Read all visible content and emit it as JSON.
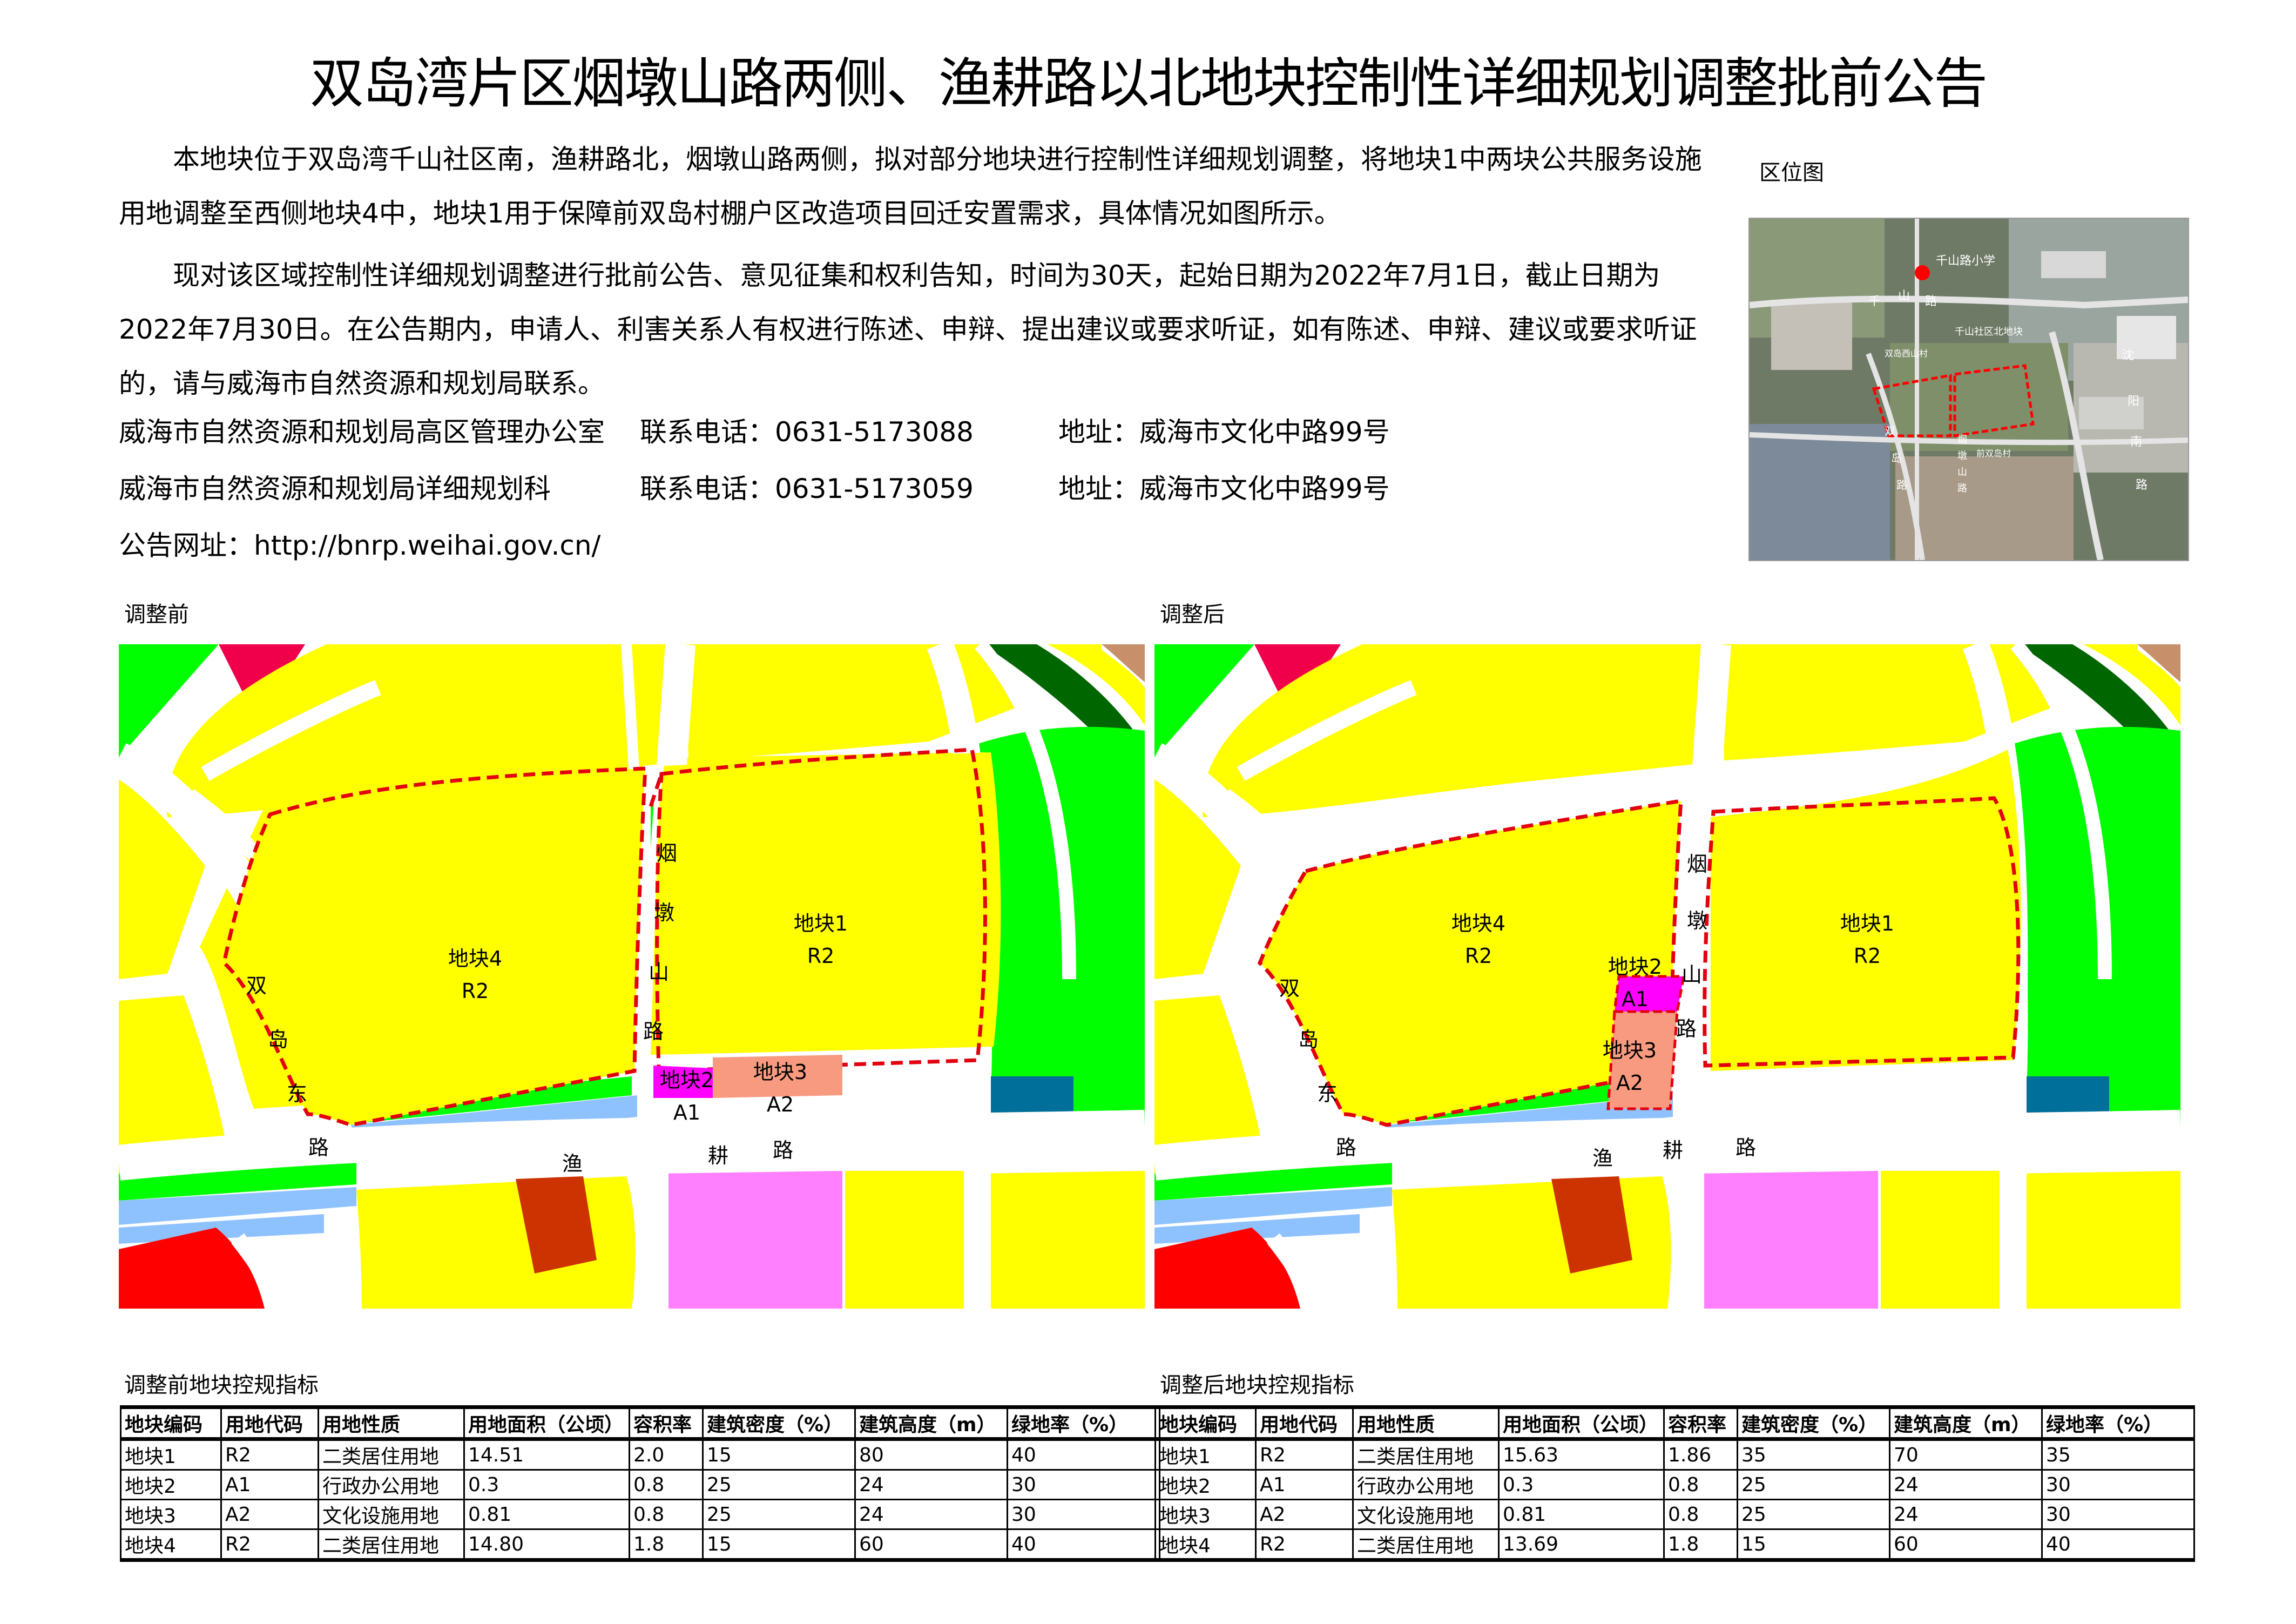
{
  "title": "双岛湾片区烟墩山路两侧、渔耕路以北地块控制性详细规划调整批前公告",
  "notice": {
    "paragraph1": "本地块位于双岛湾千山社区南，渔耕路北，烟墩山路两侧，拟对部分地块进行控制性详细规划调整，将地块1中两块公共服务设施用地调整至西侧地块4中，地块1用于保障前双岛村棚户区改造项目回迁安置需求，具体情况如图所示。",
    "paragraph2": "现对该区域控制性详细规划调整进行批前公告、意见征集和权利告知，时间为30天，起始日期为2022年7月1日，截止日期为2022年7月30日。在公告期内，申请人、利害关系人有权进行陈述、申辩、提出建议或要求听证，如有陈述、申辩、建议或要求听证的，请与威海市自然资源和规划局联系。"
  },
  "contacts": [
    {
      "office": "威海市自然资源和规划局高区管理办公室",
      "phone": "联系电话：0631-5173088",
      "address": "地址：威海市文化中路99号"
    },
    {
      "office": "威海市自然资源和规划局详细规划科",
      "phone": "联系电话：0631-5173059",
      "address": "地址：威海市文化中路99号"
    }
  ],
  "website": "公告网址：http://bnrp.weihai.gov.cn/",
  "location_map": {
    "title": "区位图",
    "labels": {
      "school": "千山路小学",
      "road_qianshan": [
        "千",
        "山",
        "路"
      ],
      "community": "千山社区北地块",
      "village": "双岛西山村",
      "road_shenyang": [
        "沈",
        "阳",
        "南",
        "路"
      ],
      "road_shuangdao": [
        "双",
        "岛",
        "路"
      ],
      "road_yandunshan": [
        "烟",
        "墩",
        "山",
        "路"
      ],
      "east_village": "前双岛村"
    }
  },
  "colors": {
    "residential": "#ffff00",
    "green": "#00ff00",
    "dark_green": "#006600",
    "red": "#ff0000",
    "crimson": "#f0004a",
    "admin": "#ff00ff",
    "culture": "#f89a80",
    "pink": "#ff80ff",
    "water_blue": "#8ec2ff",
    "teal": "#006f9a",
    "brown_red": "#cc3300",
    "tan": "#c8906a",
    "road": "#ffffff",
    "boundary": "#e3000f"
  },
  "maps": {
    "before": {
      "caption": "调整前",
      "plots": [
        {
          "name": "地块4",
          "code": "R2"
        },
        {
          "name": "地块1",
          "code": "R2"
        },
        {
          "name": "地块2",
          "code": "A1"
        },
        {
          "name": "地块3",
          "code": "A2"
        }
      ],
      "roads": {
        "yandunshan": [
          "烟",
          "墩",
          "山",
          "路"
        ],
        "shuangdaodong": [
          "双",
          "岛",
          "东",
          "路"
        ],
        "yugeng": [
          "渔",
          "耕",
          "路"
        ]
      }
    },
    "after": {
      "caption": "调整后",
      "plots": [
        {
          "name": "地块4",
          "code": "R2"
        },
        {
          "name": "地块1",
          "code": "R2"
        },
        {
          "name": "地块2",
          "code": "A1"
        },
        {
          "name": "地块3",
          "code": "A2"
        }
      ],
      "roads": {
        "yandunshan": [
          "烟",
          "墩",
          "山",
          "路"
        ],
        "shuangdaodong": [
          "双",
          "岛",
          "东",
          "路"
        ],
        "yugeng": [
          "渔",
          "耕",
          "路"
        ]
      }
    }
  },
  "tables": {
    "before": {
      "caption": "调整前地块控规指标",
      "headers": [
        "地块编码",
        "用地代码",
        "用地性质",
        "用地面积（公顷）",
        "容积率",
        "建筑密度（%）",
        "建筑高度（m）",
        "绿地率（%）"
      ],
      "rows": [
        [
          "地块1",
          "R2",
          "二类居住用地",
          "14.51",
          "2.0",
          "15",
          "80",
          "40"
        ],
        [
          "地块2",
          "A1",
          "行政办公用地",
          "0.3",
          "0.8",
          "25",
          "24",
          "30"
        ],
        [
          "地块3",
          "A2",
          "文化设施用地",
          "0.81",
          "0.8",
          "25",
          "24",
          "30"
        ],
        [
          "地块4",
          "R2",
          "二类居住用地",
          "14.80",
          "1.8",
          "15",
          "60",
          "40"
        ]
      ]
    },
    "after": {
      "caption": "调整后地块控规指标",
      "headers": [
        "地块编码",
        "用地代码",
        "用地性质",
        "用地面积（公顷）",
        "容积率",
        "建筑密度（%）",
        "建筑高度（m）",
        "绿地率（%）"
      ],
      "rows": [
        [
          "地块1",
          "R2",
          "二类居住用地",
          "15.63",
          "1.86",
          "35",
          "70",
          "35"
        ],
        [
          "地块2",
          "A1",
          "行政办公用地",
          "0.3",
          "0.8",
          "25",
          "24",
          "30"
        ],
        [
          "地块3",
          "A2",
          "文化设施用地",
          "0.81",
          "0.8",
          "25",
          "24",
          "30"
        ],
        [
          "地块4",
          "R2",
          "二类居住用地",
          "13.69",
          "1.8",
          "15",
          "60",
          "40"
        ]
      ]
    }
  }
}
